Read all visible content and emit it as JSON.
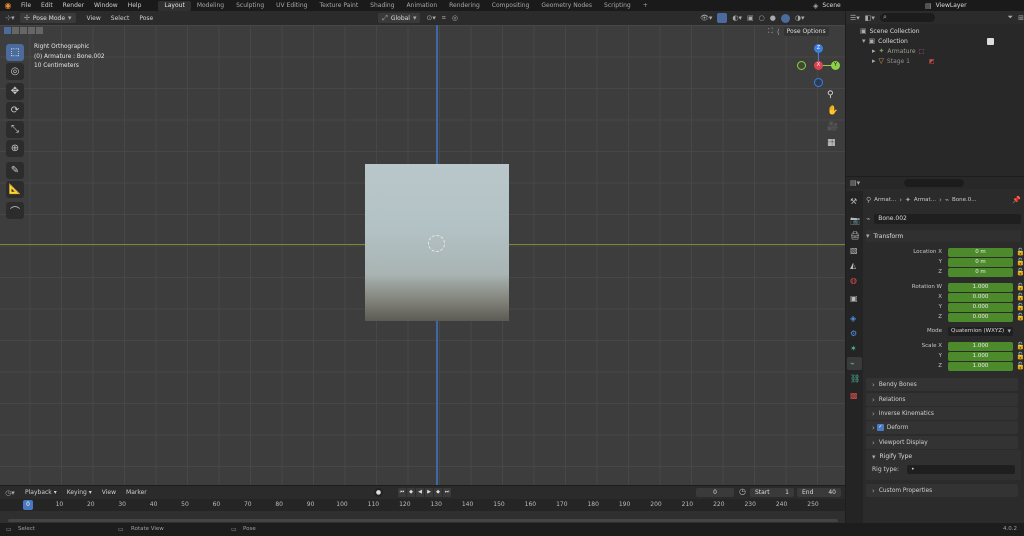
{
  "menus": [
    "File",
    "Edit",
    "Render",
    "Window",
    "Help"
  ],
  "workspaces": [
    "Layout",
    "Modeling",
    "Sculpting",
    "UV Editing",
    "Texture Paint",
    "Shading",
    "Animation",
    "Rendering",
    "Compositing",
    "Geometry Nodes",
    "Scripting"
  ],
  "active_workspace": "Layout",
  "scene_name": "Scene",
  "view_layer": "ViewLayer",
  "viewport_header": {
    "mode": "Pose Mode",
    "menus": [
      "View",
      "Select",
      "Pose"
    ],
    "transform_orientation": "Global"
  },
  "overlay": {
    "view": "Right Orthographic",
    "object": "(0) Armature : Bone.002",
    "scale": "10 Centimeters"
  },
  "pose_options_label": "Pose Options",
  "gizmo_axes": {
    "z": "Z",
    "y": "Y",
    "x": "X"
  },
  "outliner": {
    "root": "Scene Collection",
    "items": [
      {
        "label": "Collection"
      },
      {
        "label": "Armature"
      },
      {
        "label": "Stage 1"
      }
    ]
  },
  "properties": {
    "breadcrumb": [
      "Armat...",
      "Armat...",
      "Bone.0..."
    ],
    "bone_name": "Bone.002",
    "transform": {
      "title": "Transform",
      "location": {
        "label_x": "Location X",
        "label_y": "Y",
        "label_z": "Z",
        "x": "0 m",
        "y": "0 m",
        "z": "0 m"
      },
      "rotation": {
        "label_w": "Rotation W",
        "label_x": "X",
        "label_y": "Y",
        "label_z": "Z",
        "w": "1.000",
        "x": "0.000",
        "y": "0.000",
        "z": "0.000"
      },
      "mode_label": "Mode",
      "mode_value": "Quaternion (WXYZ)",
      "scale": {
        "label_x": "Scale X",
        "label_y": "Y",
        "label_z": "Z",
        "x": "1.000",
        "y": "1.000",
        "z": "1.000"
      }
    },
    "sections": [
      "Bendy Bones",
      "Relations",
      "Inverse Kinematics",
      "Deform",
      "Viewport Display"
    ],
    "rigify": {
      "title": "Rigify Type",
      "rig_type_label": "Rig type:",
      "rig_type_value": "•"
    },
    "custom_properties": "Custom Properties"
  },
  "timeline": {
    "menus": [
      "Playback",
      "Keying",
      "View",
      "Marker"
    ],
    "current_frame": "0",
    "start_label": "Start",
    "start_value": "1",
    "end_label": "End",
    "end_value": "40",
    "ticks": [
      "0",
      "10",
      "20",
      "30",
      "40",
      "50",
      "60",
      "70",
      "80",
      "90",
      "100",
      "110",
      "120",
      "130",
      "140",
      "150",
      "160",
      "170",
      "180",
      "190",
      "200",
      "210",
      "220",
      "230",
      "240",
      "250"
    ]
  },
  "status_bar": {
    "select": "Select",
    "rotate": "Rotate View",
    "pose": "Pose",
    "version": "4.0.2"
  },
  "colors": {
    "accent_blue": "#4a6b9b",
    "field_green": "#4c8a2b",
    "axis_x": "#e0424f",
    "axis_y": "#8bd045",
    "axis_z": "#3d7fe0"
  }
}
